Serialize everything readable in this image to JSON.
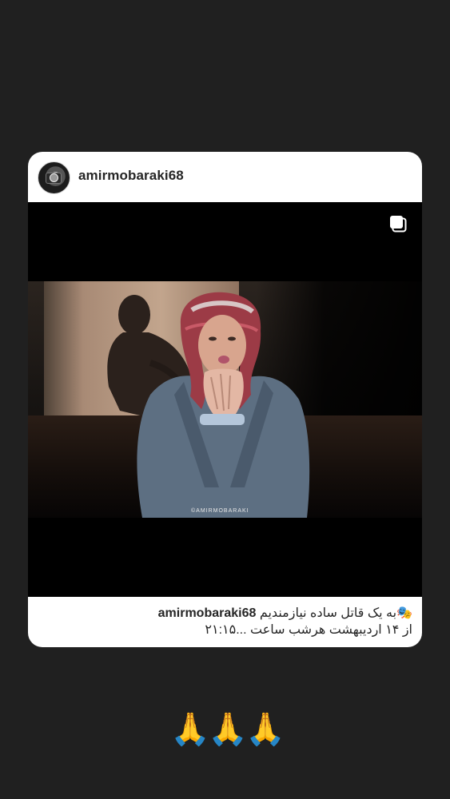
{
  "post": {
    "username": "amirmobaraki68",
    "caption_emoji": "🎭",
    "caption_line1": "به یک قاتل ساده نیازمندیم",
    "caption_line2": "از ۱۴ اردیبهشت هرشب ساعت ...۲۱:۱۵",
    "watermark": "©AMIRMOBARAKI",
    "media_type_icon": "multiple-photos-icon"
  },
  "reactions": [
    "🙏",
    "🙏",
    "🙏"
  ],
  "colors": {
    "background": "#202020",
    "card": "#ffffff",
    "text": "#262626",
    "media_bg": "#000000"
  }
}
